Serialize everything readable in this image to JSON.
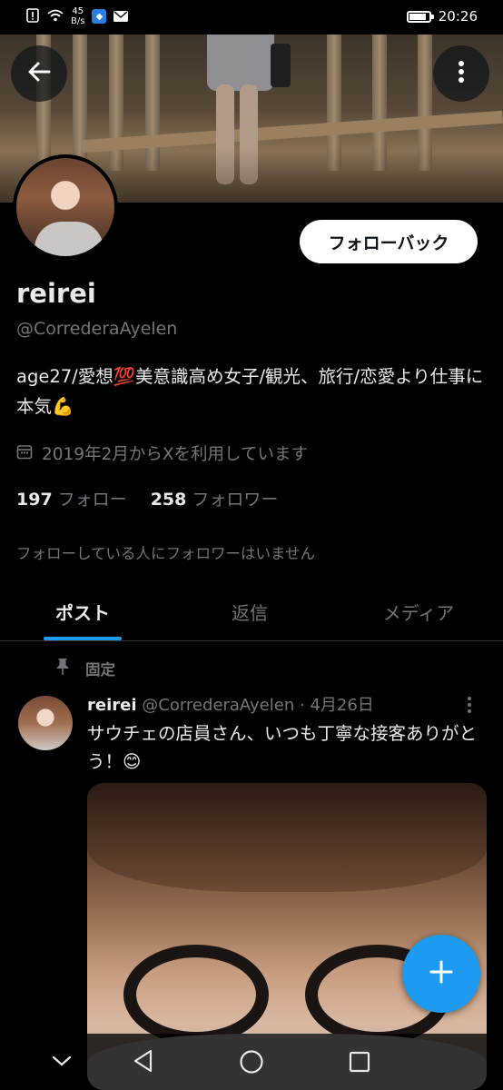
{
  "status_bar": {
    "net_speed_value": "45",
    "net_speed_unit": "B/s",
    "time": "20:26",
    "battery_level": 0.85,
    "icons": [
      "alert-icon",
      "wifi-icon",
      "shield-app-icon",
      "mail-icon",
      "battery-icon"
    ]
  },
  "header": {
    "back_icon": "arrow-left-icon",
    "more_icon": "more-vertical-icon"
  },
  "profile": {
    "follow_back_label": "フォローバック",
    "display_name": "reirei",
    "handle": "@CorrederaAyelen",
    "bio": "age27/愛想💯美意識高め女子/観光、旅行/恋愛より仕事に本気💪",
    "joined": "2019年2月からXを利用しています",
    "following_count": "197",
    "following_label": "フォロー",
    "followers_count": "258",
    "followers_label": "フォロワー",
    "followers_you_know": "フォローしている人にフォロワーはいません"
  },
  "tabs": [
    {
      "label": "ポスト",
      "active": true
    },
    {
      "label": "返信",
      "active": false
    },
    {
      "label": "メディア",
      "active": false
    }
  ],
  "pinned_post": {
    "pinned_label": "固定",
    "author_name": "reirei",
    "author_handle": "@CorrederaAyelen",
    "separator": "·",
    "date": "4月26日",
    "text": "サウチェの店員さん、いつも丁寧な接客ありがとう！😊"
  },
  "fab": {
    "icon": "plus-icon"
  },
  "navigation_bar": {
    "icons": [
      "chevron-down-icon",
      "back-triangle-icon",
      "home-circle-icon",
      "recents-square-icon"
    ]
  },
  "colors": {
    "accent": "#1d9bf0",
    "background": "#000000",
    "text_primary": "#e7e9ea",
    "text_secondary": "#71767b"
  }
}
